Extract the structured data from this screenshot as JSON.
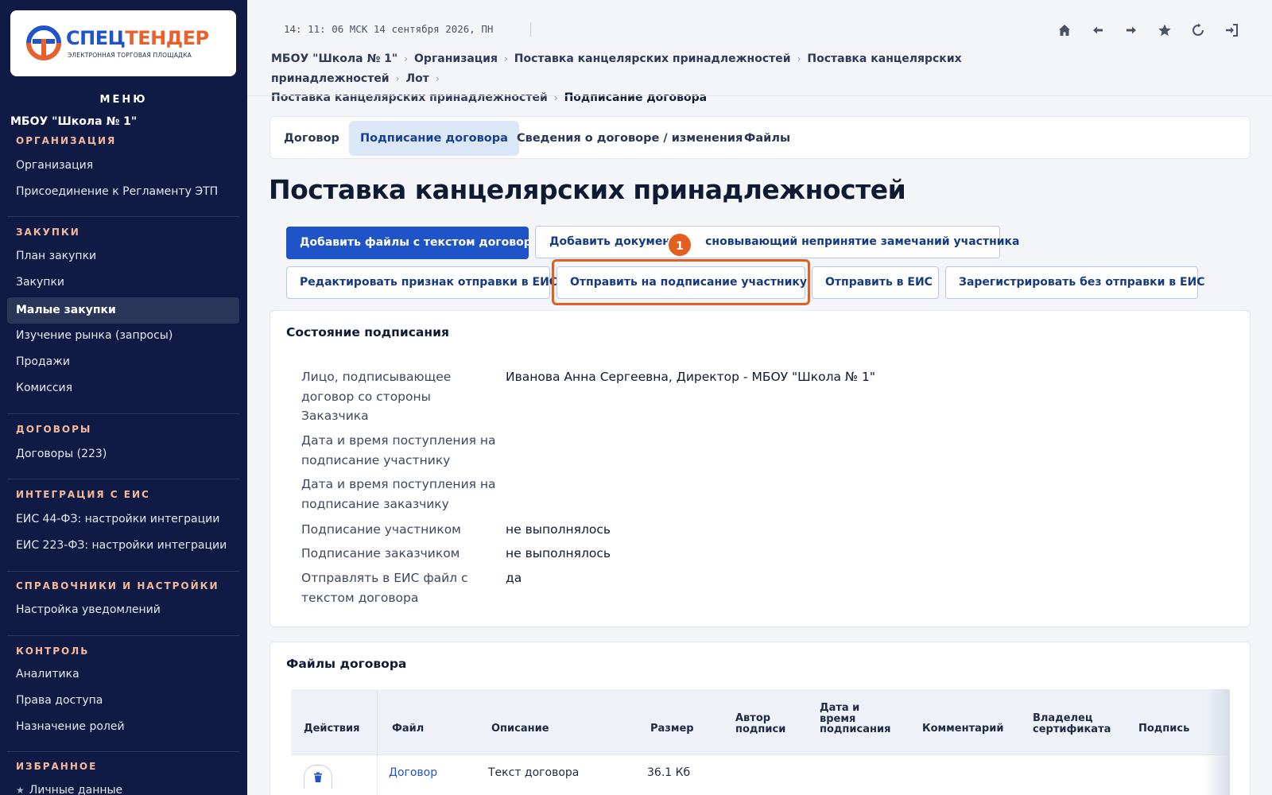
{
  "brand": {
    "name_part1": "СПЕЦ",
    "name_part2": "ТЕНДЕР",
    "tagline": "ЭЛЕКТРОННАЯ ТОРГОВАЯ ПЛОЩАДКА"
  },
  "sidebar": {
    "menu_title": "МЕНЮ",
    "org_name": "МБОУ \"Школа № 1\"",
    "sections": [
      {
        "title": "ОРГАНИЗАЦИЯ",
        "items": [
          "Организация",
          "Присоединение к Регламенту ЭТП"
        ]
      },
      {
        "title": "ЗАКУПКИ",
        "items": [
          "План закупки",
          "Закупки",
          "Малые закупки",
          "Изучение рынка (запросы)",
          "Продажи",
          "Комиссия"
        ]
      },
      {
        "title": "ДОГОВОРЫ",
        "items": [
          "Договоры (223)"
        ]
      },
      {
        "title": "ИНТЕГРАЦИЯ С ЕИС",
        "items": [
          "ЕИС 44-ФЗ: настройки интеграции",
          "ЕИС 223-ФЗ: настройки интеграции"
        ]
      },
      {
        "title": "СПРАВОЧНИКИ И НАСТРОЙКИ",
        "items": [
          "Настройка уведомлений"
        ]
      },
      {
        "title": "КОНТРОЛЬ",
        "items": [
          "Аналитика",
          "Права доступа",
          "Назначение ролей"
        ]
      },
      {
        "title": "ИЗБРАННОЕ",
        "items": [
          "Личные данные"
        ]
      }
    ],
    "active_item": "Малые закупки"
  },
  "topbar": {
    "clock": "14: 11: 06 МСК  14 сентября 2026, ПН",
    "icons": [
      "home-icon",
      "back-arrow-icon",
      "forward-arrow-icon",
      "star-icon",
      "refresh-icon",
      "logout-icon"
    ]
  },
  "breadcrumb": {
    "items": [
      "МБОУ \"Школа № 1\"",
      "Организация",
      "Поставка канцелярских принадлежностей",
      "Поставка канцелярских принадлежностей",
      "Лот",
      "Поставка канцелярских принадлежностей"
    ],
    "current": "Подписание договора",
    "separator": "›"
  },
  "tabs": [
    "Договор",
    "Подписание договора",
    "Сведения о договоре / изменения",
    "Файлы"
  ],
  "active_tab": "Подписание договора",
  "page_title": "Поставка канцелярских принадлежностей",
  "buttons": {
    "add_files": "Добавить файлы с текстом договора",
    "add_document_before": "Добавить документ",
    "add_document_after": "сновывающий непринятие замечаний участника",
    "edit_sign": "Редактировать признак отправки в ЕИС",
    "send_to_participant": "Отправить на подписание участнику",
    "send_eis": "Отправить в ЕИС",
    "register_no_eis": "Зарегистрировать без отправки в ЕИС"
  },
  "step_badge": "1",
  "signing": {
    "title": "Состояние подписания",
    "rows": [
      {
        "label": "Лицо, подписывающее договор со стороны Заказчика",
        "value": "Иванова Анна Сергеевна, Директор - МБОУ \"Школа № 1\""
      },
      {
        "label": "Дата и время поступления на подписание участнику",
        "value": ""
      },
      {
        "label": "Дата и время поступления на подписание заказчику",
        "value": ""
      },
      {
        "label": "Подписание участником",
        "value": "не выполнялось"
      },
      {
        "label": "Подписание заказчиком",
        "value": "не выполнялось"
      },
      {
        "label": "Отправлять в ЕИС файл с текстом договора",
        "value": "да"
      }
    ]
  },
  "files": {
    "title": "Файлы договора",
    "columns": [
      "Действия",
      "Файл",
      "Описание",
      "Размер",
      "Автор подписи",
      "Дата и время подписания",
      "Комментарий",
      "Владелец сертификата",
      "Подпись"
    ],
    "rows": [
      {
        "file": "Договор",
        "description": "Текст договора",
        "size": "36.1 Кб"
      }
    ]
  },
  "colors": {
    "sidebar_bg": "#0f1b44",
    "section_title": "#f5b89a",
    "primary": "#1f54c9",
    "highlight": "#e25f1f",
    "active_tab_bg": "#dbe6f7"
  }
}
